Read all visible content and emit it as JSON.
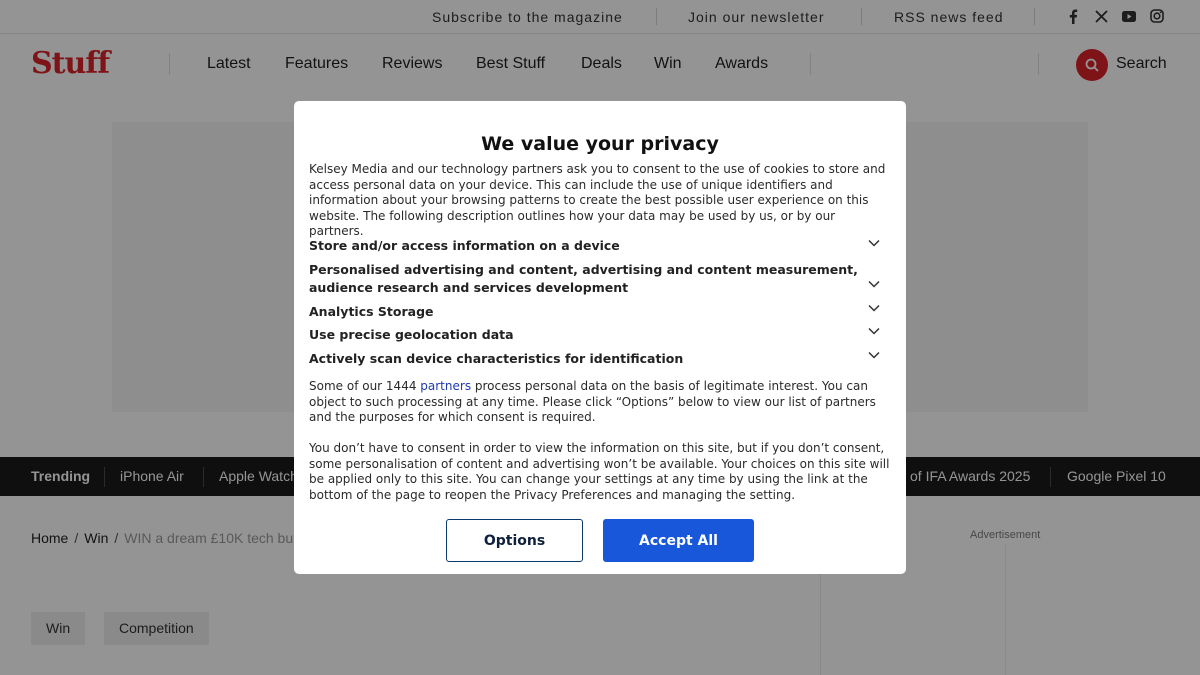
{
  "topbar": {
    "subscribe": "Subscribe to the magazine",
    "newsletter": "Join our newsletter",
    "rss": "RSS news feed",
    "social_icons": [
      "facebook-icon",
      "x-icon",
      "youtube-icon",
      "instagram-icon"
    ]
  },
  "header": {
    "logo": "Stuff",
    "nav": [
      "Latest",
      "Features",
      "Reviews",
      "Best Stuff",
      "Deals",
      "Win",
      "Awards"
    ],
    "search_label": "Search"
  },
  "trending": {
    "label": "Trending",
    "items": [
      "iPhone Air",
      "Apple Watch",
      "of IFA Awards 2025",
      "Google Pixel 10"
    ]
  },
  "breadcrumb": {
    "home": "Home",
    "section": "Win",
    "current": "WIN a dream £10K tech bu"
  },
  "sidebar": {
    "advertisement": "Advertisement"
  },
  "tags": [
    "Win",
    "Competition"
  ],
  "consent": {
    "title": "We value your privacy",
    "intro": "Kelsey Media and our technology partners ask you to consent to the use of cookies to store and access personal data on your device. This can include the use of unique identifiers and information about your browsing patterns to create the best possible user experience on this website. The following description outlines how your data may be used by us, or by our partners.",
    "purposes": [
      "Store and/or access information on a device",
      "Personalised advertising and content, advertising and content measurement, audience research and services development",
      "Analytics Storage",
      "Use precise geolocation data",
      "Actively scan device characteristics for identification"
    ],
    "legit_before": "Some of our 1444 ",
    "legit_link": "partners",
    "legit_after": " process personal data on the basis of legitimate interest. You can object to such processing at any time. Please click “Options” below to view our list of partners and the purposes for which consent is required.",
    "no_consent": "You don’t have to consent in order to view the information on this site, but if you don’t consent, some personalisation of content and advertising won’t be available. Your choices on this site will be applied only to this site. You can change your settings at any time by using the link at the bottom of the page to reopen the Privacy Preferences and managing the setting.",
    "options_label": "Options",
    "accept_label": "Accept All",
    "colors": {
      "accept": "#1857d9",
      "link": "#1f3bb3"
    }
  },
  "colors": {
    "brand": "#d9232a",
    "trending_bg": "#1a1a1a"
  }
}
